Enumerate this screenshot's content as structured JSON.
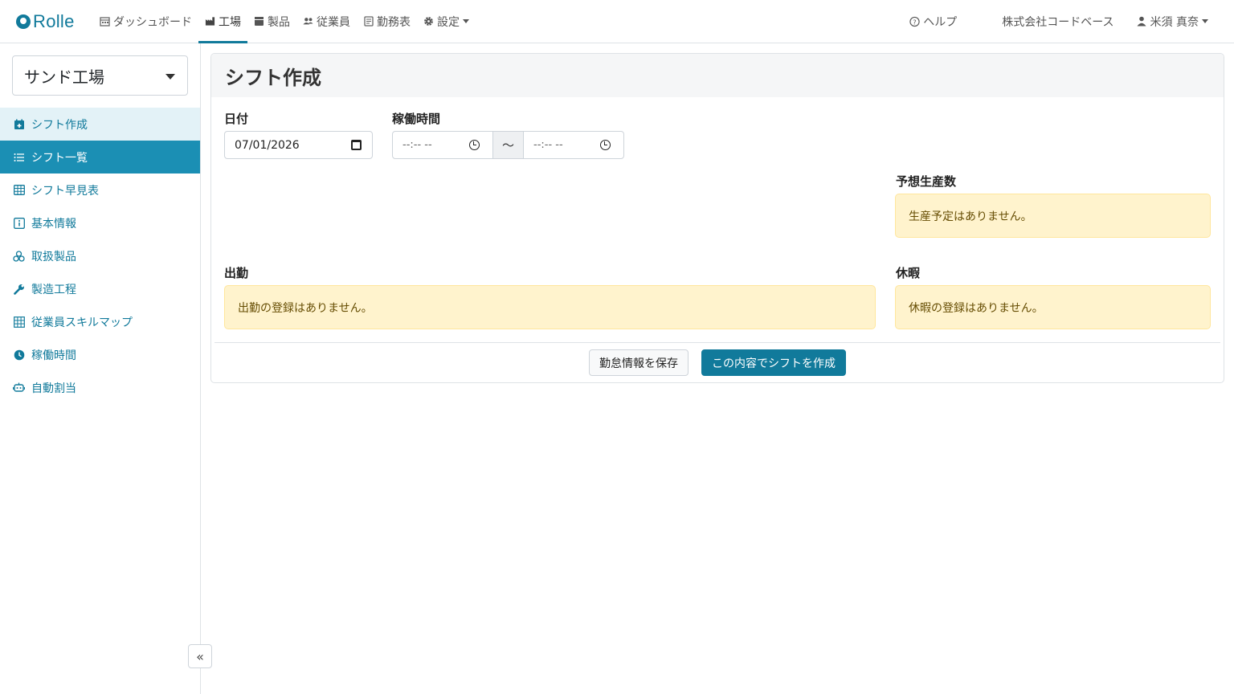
{
  "brand": {
    "name": "Rolle"
  },
  "nav": {
    "items": [
      {
        "label": "ダッシュボード",
        "icon": "calendar-icon"
      },
      {
        "label": "工場",
        "icon": "industry-icon"
      },
      {
        "label": "製品",
        "icon": "box-icon"
      },
      {
        "label": "従業員",
        "icon": "users-icon"
      },
      {
        "label": "勤務表",
        "icon": "document-icon"
      },
      {
        "label": "設定",
        "icon": "gear-icon"
      }
    ],
    "help": "ヘルプ",
    "company": "株式会社コードベース",
    "user": "米須 真奈"
  },
  "sidebar": {
    "factory": "サンド工場",
    "items": [
      {
        "label": "シフト作成",
        "icon": "calendar-plus-icon"
      },
      {
        "label": "シフト一覧",
        "icon": "list-icon"
      },
      {
        "label": "シフト早見表",
        "icon": "table-icon"
      },
      {
        "label": "基本情報",
        "icon": "info-icon"
      },
      {
        "label": "取扱製品",
        "icon": "boxes-icon"
      },
      {
        "label": "製造工程",
        "icon": "wrench-icon"
      },
      {
        "label": "従業員スキルマップ",
        "icon": "grid-icon"
      },
      {
        "label": "稼働時間",
        "icon": "clock-icon"
      },
      {
        "label": "自動割当",
        "icon": "robot-icon"
      }
    ],
    "collapse": "«"
  },
  "main": {
    "title": "シフト作成",
    "date_label": "日付",
    "date_value": "07/01/2026",
    "hours_label": "稼働時間",
    "time_start": "--:-- --",
    "time_sep": "〜",
    "time_end": "--:-- --",
    "forecast_label": "予想生産数",
    "forecast_empty": "生産予定はありません。",
    "attendance_label": "出勤",
    "attendance_empty": "出勤の登録はありません。",
    "leave_label": "休暇",
    "leave_empty": "休暇の登録はありません。",
    "save_button": "勤怠情報を保存",
    "create_button": "この内容でシフトを作成"
  }
}
